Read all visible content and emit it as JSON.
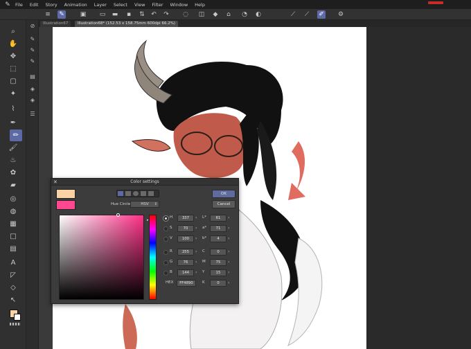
{
  "menu": [
    "File",
    "Edit",
    "Story",
    "Animation",
    "Layer",
    "Select",
    "View",
    "Filter",
    "Window",
    "Help"
  ],
  "tabs": [
    {
      "label": "Illustration67"
    },
    {
      "label": "Illustration68* (152.53 x 158.75mm 600dpi 66.2%)"
    }
  ],
  "dialog": {
    "title": "Color settings",
    "ok": "OK",
    "cancel": "Cancel",
    "hue_circle_label": "Hue Circle",
    "color_mode": "HSV",
    "current_color": "#ff4890",
    "previous_color": "#f9d3a6",
    "hsv": [
      {
        "label": "H",
        "value": "337",
        "selected": true
      },
      {
        "label": "S",
        "value": "70",
        "selected": false
      },
      {
        "label": "V",
        "value": "100",
        "selected": false
      }
    ],
    "rgb": [
      {
        "label": "R",
        "value": "255"
      },
      {
        "label": "G",
        "value": "76"
      },
      {
        "label": "B",
        "value": "144"
      }
    ],
    "lab": [
      {
        "label": "L*",
        "value": "61"
      },
      {
        "label": "a*",
        "value": "71"
      },
      {
        "label": "b*",
        "value": "4"
      }
    ],
    "cmyk": [
      {
        "label": "C",
        "value": "0"
      },
      {
        "label": "M",
        "value": "75"
      },
      {
        "label": "Y",
        "value": "15"
      },
      {
        "label": "K",
        "value": "0"
      }
    ],
    "hex_label": "HEX",
    "hex_value": "FF4890"
  }
}
